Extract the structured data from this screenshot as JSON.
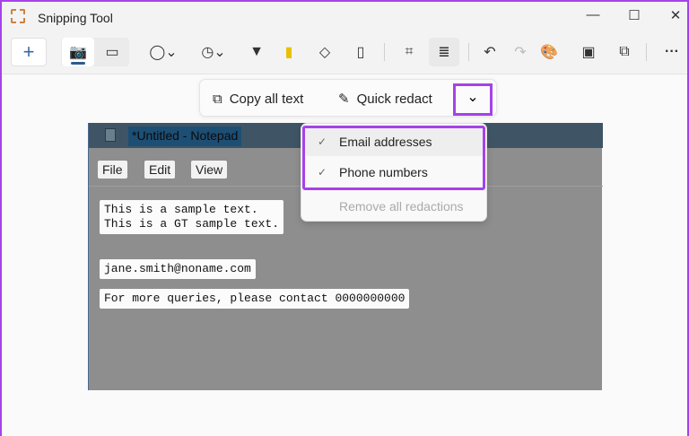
{
  "window": {
    "title": "Snipping Tool",
    "minimize": "—",
    "maximize": "☐",
    "close": "✕"
  },
  "toolbar": {
    "new": "+",
    "more": "···"
  },
  "text_actions": {
    "copy_all_text": "Copy all text",
    "quick_redact": "Quick redact",
    "dropdown": "⌄"
  },
  "redact_menu": {
    "items": [
      {
        "label": "Email addresses",
        "checked": true
      },
      {
        "label": "Phone numbers",
        "checked": true
      },
      {
        "label": "Remove all redactions",
        "disabled": true
      }
    ],
    "check": "✓"
  },
  "capture": {
    "title": "*Untitled - Notepad",
    "menus": [
      "File",
      "Edit",
      "View"
    ],
    "lines": [
      "This is a sample text.\nThis is a GT sample text.",
      "jane.smith@noname.com",
      "For more queries, please contact 0000000000"
    ]
  }
}
